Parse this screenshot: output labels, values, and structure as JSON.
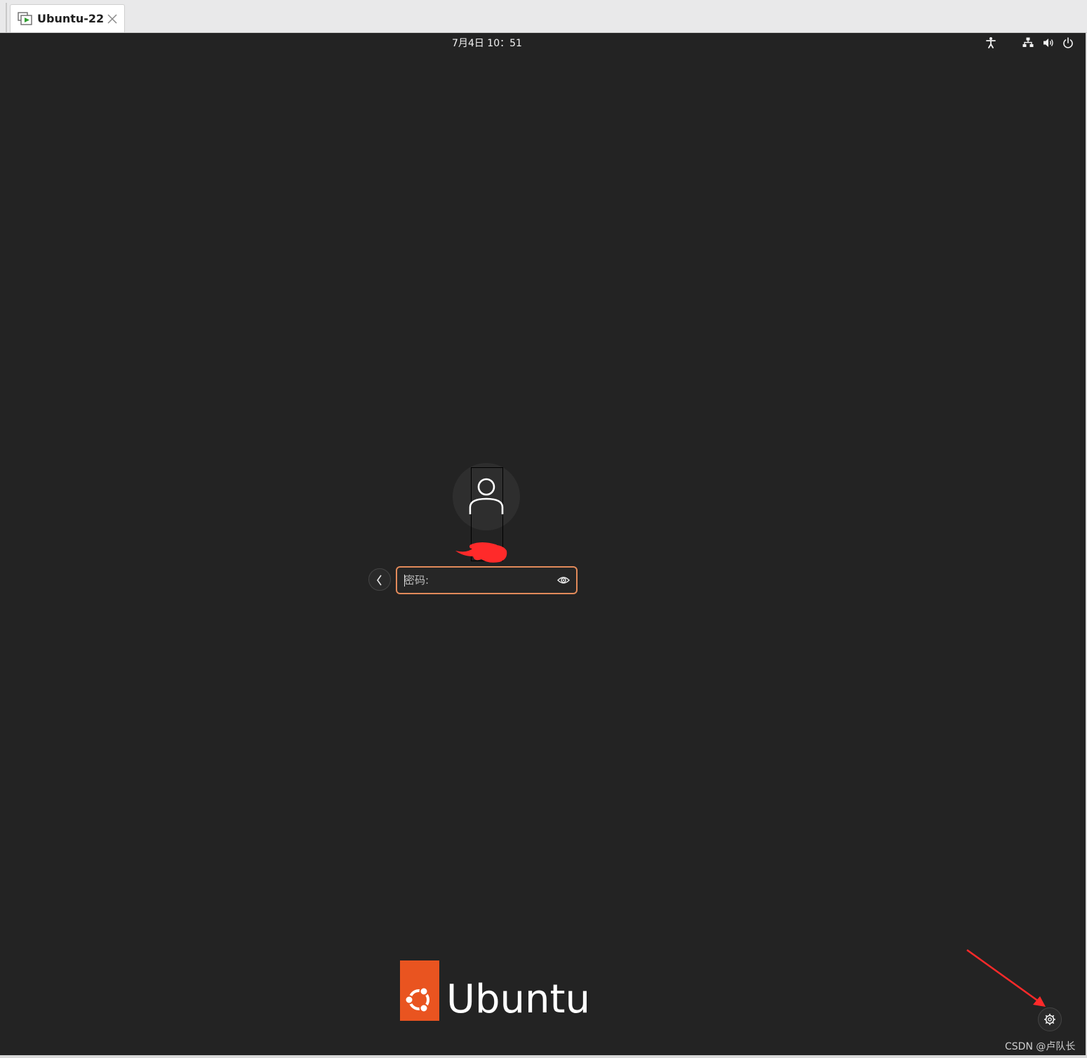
{
  "host": {
    "tab": {
      "title": "Ubuntu-22",
      "icon": "vm-play-icon",
      "close_icon": "close-icon"
    }
  },
  "topbar": {
    "clock": "7月4日  10：51",
    "tray_icons": [
      "accessibility-icon",
      "network-icon",
      "volume-icon",
      "power-icon"
    ]
  },
  "login": {
    "avatar_icon": "user-avatar-icon",
    "back_icon": "chevron-left-icon",
    "password": {
      "placeholder": "密码:",
      "value": "",
      "reveal_icon": "eye-icon"
    }
  },
  "branding": {
    "logo_text": "Ubuntu",
    "brand_color": "#e95420",
    "focus_color": "#e28a5a"
  },
  "session_button_icon": "gear-icon",
  "watermark": "CSDN @卢队长"
}
